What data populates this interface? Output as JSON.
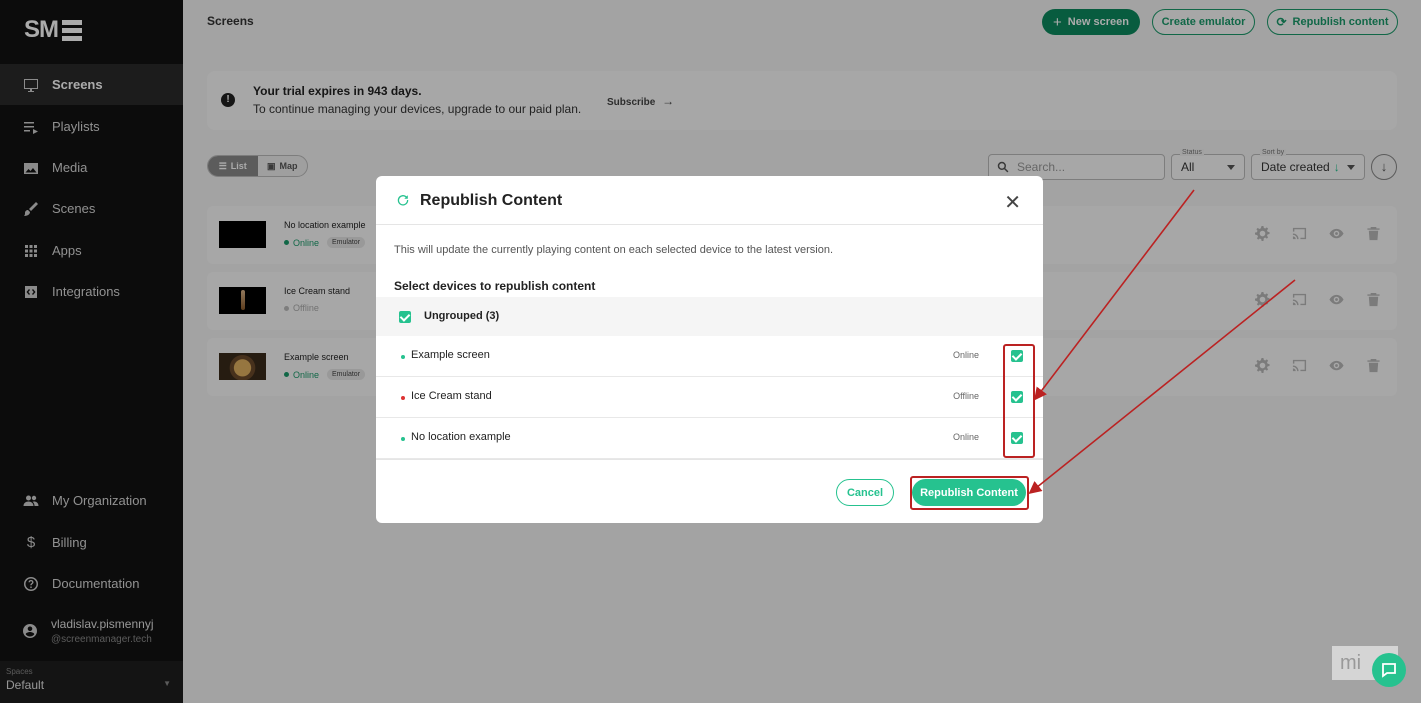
{
  "brand": {
    "logo_text": "SM"
  },
  "sidebar": {
    "items": [
      {
        "label": "Screens",
        "icon": "monitor-icon",
        "active": true
      },
      {
        "label": "Playlists",
        "icon": "playlist-icon"
      },
      {
        "label": "Media",
        "icon": "image-icon"
      },
      {
        "label": "Scenes",
        "icon": "brush-icon"
      },
      {
        "label": "Apps",
        "icon": "apps-grid-icon"
      },
      {
        "label": "Integrations",
        "icon": "code-box-icon"
      }
    ],
    "bottom_items": [
      {
        "label": "My Organization",
        "icon": "people-icon"
      },
      {
        "label": "Billing",
        "icon": "dollar-icon"
      },
      {
        "label": "Documentation",
        "icon": "help-circle-icon"
      }
    ],
    "user": {
      "name": "vladislav.pismennyj",
      "email": "@screenmanager.tech"
    },
    "spaces": {
      "label": "Spaces",
      "value": "Default"
    }
  },
  "header": {
    "title": "Screens",
    "new_screen": "New screen",
    "create_emulator": "Create emulator",
    "republish": "Republish content"
  },
  "trial": {
    "title": "Your trial expires in 943 days.",
    "message": "To continue managing your devices, upgrade to our paid plan.",
    "subscribe": "Subscribe"
  },
  "view_toggle": {
    "list": "List",
    "map": "Map"
  },
  "filters": {
    "search_placeholder": "Search...",
    "status_label": "Status",
    "status_value": "All",
    "sort_label": "Sort by",
    "sort_value": "Date created"
  },
  "screens": [
    {
      "name": "No location example",
      "status": "Online",
      "badge": "Emulator"
    },
    {
      "name": "Ice Cream stand",
      "status": "Offline",
      "badge": ""
    },
    {
      "name": "Example screen",
      "status": "Online",
      "badge": "Emulator"
    }
  ],
  "modal": {
    "title": "Republish Content",
    "description": "This will update the currently playing content on each selected device to the latest version.",
    "select_title": "Select devices to republish content",
    "group_label": "Ungrouped (3)",
    "devices": [
      {
        "name": "Example screen",
        "status": "Online",
        "checked": true
      },
      {
        "name": "Ice Cream stand",
        "status": "Offline",
        "checked": true
      },
      {
        "name": "No location example",
        "status": "Online",
        "checked": true
      }
    ],
    "cancel": "Cancel",
    "confirm": "Republish Content"
  },
  "colors": {
    "accent": "#26c28f",
    "dark_green": "#0d8a5e",
    "sidebar_bg": "#121212",
    "annotation_red": "#b22222"
  },
  "watermark": "mi"
}
